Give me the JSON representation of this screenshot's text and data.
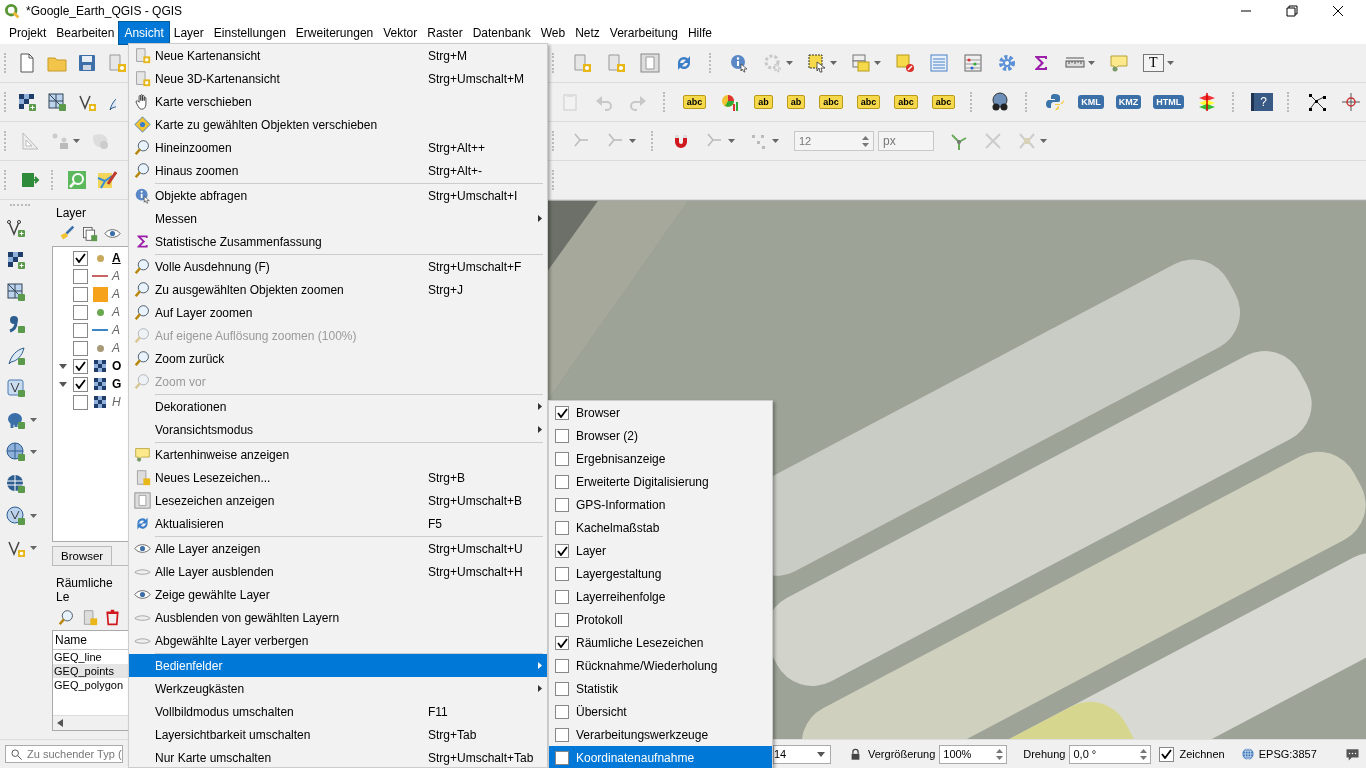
{
  "window": {
    "title": "*Google_Earth_QGIS - QGIS"
  },
  "menubar": [
    {
      "label": "Projekt",
      "selected": false
    },
    {
      "label": "Bearbeiten",
      "selected": false
    },
    {
      "label": "Ansicht",
      "selected": true
    },
    {
      "label": "Layer",
      "selected": false
    },
    {
      "label": "Einstellungen",
      "selected": false
    },
    {
      "label": "Erweiterungen",
      "selected": false
    },
    {
      "label": "Vektor",
      "selected": false
    },
    {
      "label": "Raster",
      "selected": false
    },
    {
      "label": "Datenbank",
      "selected": false
    },
    {
      "label": "Web",
      "selected": false
    },
    {
      "label": "Netz",
      "selected": false
    },
    {
      "label": "Verarbeitung",
      "selected": false
    },
    {
      "label": "Hilfe",
      "selected": false
    }
  ],
  "toolbars": {
    "label_tools": [
      "abc",
      "ab",
      "ab",
      "abc",
      "abc",
      "abc",
      "abc"
    ],
    "export_tools": [
      "KML",
      "KMZ",
      "HTML"
    ],
    "help": "?",
    "text_annotation": "T",
    "tolerance_value": "12",
    "tolerance_unit": "px"
  },
  "layers_panel": {
    "title": "Layer",
    "layers": [
      {
        "name": "A",
        "checked": true,
        "bold": true,
        "kind": "point",
        "color": "#c8a85a"
      },
      {
        "name": "A",
        "checked": false,
        "bold": false,
        "kind": "line",
        "color": "#c86464"
      },
      {
        "name": "A",
        "checked": false,
        "bold": false,
        "kind": "polygon",
        "color": "#f7a21b"
      },
      {
        "name": "A",
        "checked": false,
        "bold": false,
        "kind": "point",
        "color": "#6aa84f"
      },
      {
        "name": "A",
        "checked": false,
        "bold": false,
        "kind": "line",
        "color": "#3d85c6"
      },
      {
        "name": "A",
        "checked": false,
        "bold": false,
        "kind": "point",
        "color": "#a89a78"
      },
      {
        "name": "O",
        "checked": true,
        "bold": true,
        "kind": "raster",
        "expanded": true
      },
      {
        "name": "G",
        "checked": true,
        "bold": true,
        "kind": "raster",
        "expanded": true
      },
      {
        "name": "H",
        "checked": false,
        "bold": false,
        "kind": "raster"
      }
    ]
  },
  "dock_tabs": [
    {
      "label": "Browser"
    }
  ],
  "bookmarks_panel": {
    "title": "Räumliche Le",
    "column": "Name",
    "rows": [
      {
        "name": "GEQ_line",
        "selected": false
      },
      {
        "name": "GEQ_points",
        "selected": true
      },
      {
        "name": "GEQ_polygon",
        "selected": false
      }
    ]
  },
  "view_menu": [
    {
      "label": "Neue Kartenansicht",
      "shortcut": "Strg+M",
      "submenu": false,
      "disabled": false,
      "selected": false,
      "separator_after": false
    },
    {
      "label": "Neue 3D-Kartenansicht",
      "shortcut": "Strg+Umschalt+M",
      "submenu": false,
      "disabled": false,
      "selected": false,
      "separator_after": false
    },
    {
      "label": "Karte verschieben",
      "submenu": false,
      "disabled": false,
      "selected": false,
      "separator_after": false
    },
    {
      "label": "Karte zu gewählten Objekten verschieben",
      "submenu": false,
      "disabled": false,
      "selected": false,
      "separator_after": false
    },
    {
      "label": "Hineinzoomen",
      "shortcut": "Strg+Alt++",
      "submenu": false,
      "disabled": false,
      "selected": false,
      "separator_after": false
    },
    {
      "label": "Hinaus zoomen",
      "shortcut": "Strg+Alt+-",
      "submenu": false,
      "disabled": false,
      "selected": false,
      "separator_after": true
    },
    {
      "label": "Objekte abfragen",
      "shortcut": "Strg+Umschalt+I",
      "submenu": false,
      "disabled": false,
      "selected": false,
      "separator_after": false
    },
    {
      "label": "Messen",
      "submenu": true,
      "disabled": false,
      "selected": false,
      "separator_after": false
    },
    {
      "label": "Statistische Zusammenfassung",
      "submenu": false,
      "disabled": false,
      "selected": false,
      "separator_after": true
    },
    {
      "label": "Volle Ausdehnung (F)",
      "shortcut": "Strg+Umschalt+F",
      "submenu": false,
      "disabled": false,
      "selected": false,
      "separator_after": false
    },
    {
      "label": "Zu ausgewählten Objekten zoomen",
      "shortcut": "Strg+J",
      "submenu": false,
      "disabled": false,
      "selected": false,
      "separator_after": false
    },
    {
      "label": "Auf Layer zoomen",
      "submenu": false,
      "disabled": false,
      "selected": false,
      "separator_after": false
    },
    {
      "label": "Auf eigene Auflösung zoomen (100%)",
      "submenu": false,
      "disabled": true,
      "selected": false,
      "separator_after": false
    },
    {
      "label": "Zoom zurück",
      "submenu": false,
      "disabled": false,
      "selected": false,
      "separator_after": false
    },
    {
      "label": "Zoom vor",
      "submenu": false,
      "disabled": true,
      "selected": false,
      "separator_after": true
    },
    {
      "label": "Dekorationen",
      "submenu": true,
      "disabled": false,
      "selected": false,
      "separator_after": false
    },
    {
      "label": "Voransichtsmodus",
      "submenu": true,
      "disabled": false,
      "selected": false,
      "separator_after": true
    },
    {
      "label": "Kartenhinweise anzeigen",
      "submenu": false,
      "disabled": false,
      "selected": false,
      "separator_after": false
    },
    {
      "label": "Neues Lesezeichen...",
      "shortcut": "Strg+B",
      "submenu": false,
      "disabled": false,
      "selected": false,
      "separator_after": false
    },
    {
      "label": "Lesezeichen anzeigen",
      "shortcut": "Strg+Umschalt+B",
      "submenu": false,
      "disabled": false,
      "selected": false,
      "separator_after": false
    },
    {
      "label": "Aktualisieren",
      "shortcut": "F5",
      "submenu": false,
      "disabled": false,
      "selected": false,
      "separator_after": true
    },
    {
      "label": "Alle Layer anzeigen",
      "shortcut": "Strg+Umschalt+U",
      "submenu": false,
      "disabled": false,
      "selected": false,
      "separator_after": false
    },
    {
      "label": "Alle Layer ausblenden",
      "shortcut": "Strg+Umschalt+H",
      "submenu": false,
      "disabled": false,
      "selected": false,
      "separator_after": false
    },
    {
      "label": "Zeige gewählte Layer",
      "submenu": false,
      "disabled": false,
      "selected": false,
      "separator_after": false
    },
    {
      "label": "Ausblenden von gewählten Layern",
      "submenu": false,
      "disabled": false,
      "selected": false,
      "separator_after": false
    },
    {
      "label": "Abgewählte Layer verbergen",
      "submenu": false,
      "disabled": false,
      "selected": false,
      "separator_after": true
    },
    {
      "label": "Bedienfelder",
      "submenu": true,
      "disabled": false,
      "selected": true,
      "separator_after": false
    },
    {
      "label": "Werkzeugkästen",
      "submenu": true,
      "disabled": false,
      "selected": false,
      "separator_after": false
    },
    {
      "label": "Vollbildmodus umschalten",
      "shortcut": "F11",
      "submenu": false,
      "disabled": false,
      "selected": false,
      "separator_after": false
    },
    {
      "label": "Layersichtbarkeit umschalten",
      "shortcut": "Strg+Tab",
      "submenu": false,
      "disabled": false,
      "selected": false,
      "separator_after": false
    },
    {
      "label": "Nur Karte umschalten",
      "shortcut": "Strg+Umschalt+Tab",
      "submenu": false,
      "disabled": false,
      "selected": false,
      "separator_after": false
    }
  ],
  "panels_submenu": [
    {
      "label": "Browser",
      "checked": true,
      "selected": false
    },
    {
      "label": "Browser (2)",
      "checked": false,
      "selected": false
    },
    {
      "label": "Ergebnisanzeige",
      "checked": false,
      "selected": false
    },
    {
      "label": "Erweiterte Digitalisierung",
      "checked": false,
      "selected": false
    },
    {
      "label": "GPS-Information",
      "checked": false,
      "selected": false
    },
    {
      "label": "Kachelmaßstab",
      "checked": false,
      "selected": false
    },
    {
      "label": "Layer",
      "checked": true,
      "selected": false
    },
    {
      "label": "Layergestaltung",
      "checked": false,
      "selected": false
    },
    {
      "label": "Layerreihenfolge",
      "checked": false,
      "selected": false
    },
    {
      "label": "Protokoll",
      "checked": false,
      "selected": false
    },
    {
      "label": "Räumliche Lesezeichen",
      "checked": true,
      "selected": false
    },
    {
      "label": "Rücknahme/Wiederholung",
      "checked": false,
      "selected": false
    },
    {
      "label": "Statistik",
      "checked": false,
      "selected": false
    },
    {
      "label": "Übersicht",
      "checked": false,
      "selected": false
    },
    {
      "label": "Verarbeitungswerkzeuge",
      "checked": false,
      "selected": false
    },
    {
      "label": "Koordinatenaufnahme",
      "checked": false,
      "selected": true
    }
  ],
  "status_bar": {
    "search_placeholder": "Zu suchender Typ (",
    "scale": "14",
    "magnifier_label": "Vergrößerung",
    "magnifier": "100%",
    "rotation_label": "Drehung",
    "rotation": "0,0 °",
    "render": {
      "label": "Zeichnen",
      "checked": true
    },
    "crs": "EPSG:3857"
  }
}
